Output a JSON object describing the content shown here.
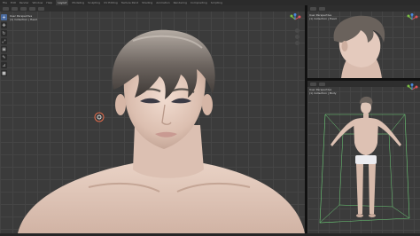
{
  "menu": {
    "items": [
      "File",
      "Edit",
      "Render",
      "Window",
      "Help",
      "Layout",
      "Modeling",
      "Sculpting",
      "UV Editing",
      "Texture Paint",
      "Shading",
      "Animation",
      "Rendering",
      "Compositing",
      "Scripting"
    ],
    "active_index": 5
  },
  "main_viewport": {
    "overlay_lines": [
      "User Perspective",
      "(1) Collection | Head"
    ],
    "tools": [
      "cursor-tool",
      "move-tool",
      "rotate-tool",
      "scale-tool",
      "transform-tool",
      "annotate-tool",
      "measure-tool",
      "add-cube-tool"
    ]
  },
  "top_right_viewport": {
    "overlay_lines": [
      "User Perspective",
      "(1) Collection | Head"
    ]
  },
  "bottom_right_viewport": {
    "overlay_lines": [
      "User Perspective",
      "(1) Collection | Body"
    ]
  },
  "colors": {
    "viewport_bg": "#3b3b3b",
    "grid_line": "#454545",
    "header_bg": "#2e2e2e",
    "selection_blue": "#4a6a9e",
    "camera_line": "#6fd17a"
  }
}
